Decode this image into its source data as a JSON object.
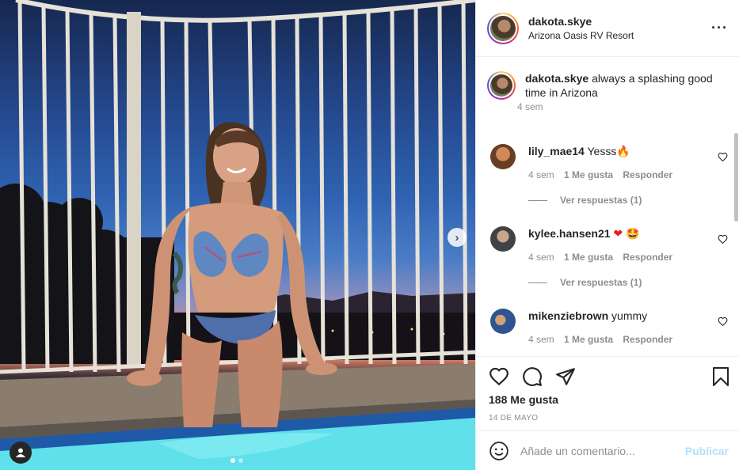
{
  "post": {
    "username": "dakota.skye",
    "location": "Arizona Oasis RV Resort",
    "more_icon": "more-horizontal-icon",
    "caption": "always a splashing good time in Arizona",
    "caption_time": "4 sem"
  },
  "comments": [
    {
      "username": "lily_mae14",
      "text": "Yesss",
      "emoji": "🔥",
      "time": "4 sem",
      "likes": "1 Me gusta",
      "reply_label": "Responder",
      "view_replies": "Ver respuestas (1)",
      "avatar_color": "#8a5a3a"
    },
    {
      "username": "kylee.hansen21",
      "text": "",
      "emoji": "❤ 🤩",
      "time": "4 sem",
      "likes": "1 Me gusta",
      "reply_label": "Responder",
      "view_replies": "Ver respuestas (1)",
      "avatar_color": "#6b6f74"
    },
    {
      "username": "mikenziebrown",
      "text": "yummy",
      "emoji": "",
      "time": "4 sem",
      "likes": "1 Me gusta",
      "reply_label": "Responder",
      "view_replies": "",
      "avatar_color": "#3a5d8f"
    }
  ],
  "actions": {
    "likes_count": "188 Me gusta",
    "date": "14 DE MAYO"
  },
  "composer": {
    "placeholder": "Añade un comentario...",
    "publish_label": "Publicar"
  },
  "carousel": {
    "next_icon": "chevron-right-icon",
    "slide_count": 2,
    "active_slide": 1
  },
  "colors": {
    "accent_blue": "#0095f6",
    "publish_disabled": "#b2dffc",
    "muted_text": "#8e8e8e"
  }
}
